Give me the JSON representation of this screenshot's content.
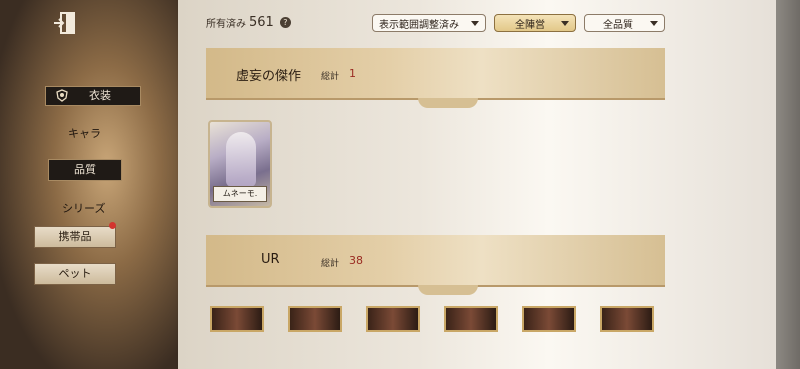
{
  "sidebar": {
    "items": [
      {
        "label": "衣装",
        "state": "selected"
      },
      {
        "label": "キャラ",
        "state": "normal"
      },
      {
        "label": "品質",
        "state": "selected"
      },
      {
        "label": "シリーズ",
        "state": "normal"
      },
      {
        "label": "携帯品",
        "state": "button",
        "badge": "red-dot"
      },
      {
        "label": "ペット",
        "state": "button"
      }
    ]
  },
  "header": {
    "owned_label": "所有済み",
    "owned_count": "561",
    "help": "?",
    "filters": [
      {
        "label": "表示範囲調整済み"
      },
      {
        "label": "全陣営"
      },
      {
        "label": "全品質"
      }
    ]
  },
  "sections": [
    {
      "title": "虚妄の傑作",
      "total_label": "総計",
      "total": "1",
      "cards": [
        {
          "name": "ムネーモ."
        }
      ]
    },
    {
      "title": "UR",
      "total_label": "総計",
      "total": "38"
    }
  ],
  "colors": {
    "accent_gold": "#e2c889",
    "total_red": "#9a2b22",
    "badge_red": "#d3342e"
  }
}
